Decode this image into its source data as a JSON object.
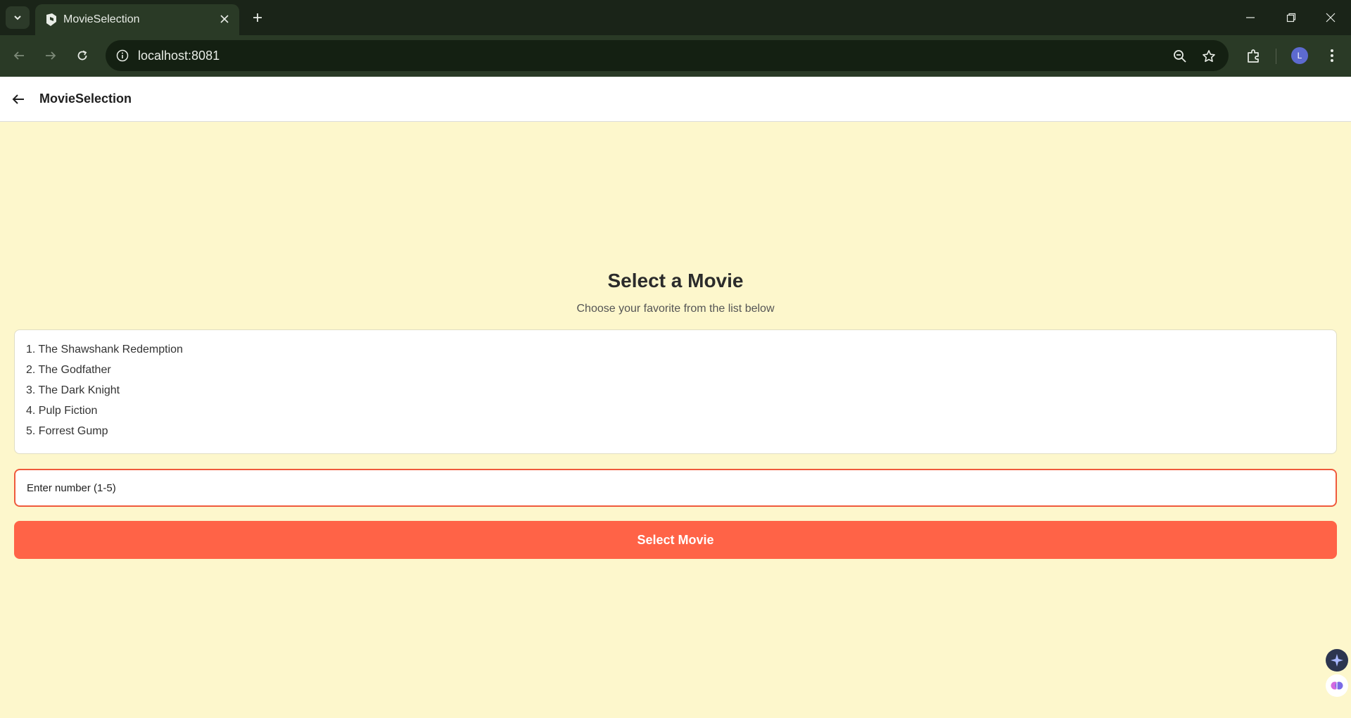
{
  "browser": {
    "tab_title": "MovieSelection",
    "url": "localhost:8081",
    "profile_initial": "L"
  },
  "app": {
    "title": "MovieSelection"
  },
  "main": {
    "heading": "Select a Movie",
    "subheading": "Choose your favorite from the list below",
    "movies": [
      "1. The Shawshank Redemption",
      "2. The Godfather",
      "3. The Dark Knight",
      "4. Pulp Fiction",
      "5. Forrest Gump"
    ],
    "input_placeholder": "Enter number (1-5)",
    "button_label": "Select Movie"
  },
  "colors": {
    "page_background": "#fdf7cc",
    "accent": "#ff6347",
    "input_border": "#ef5a3c"
  }
}
